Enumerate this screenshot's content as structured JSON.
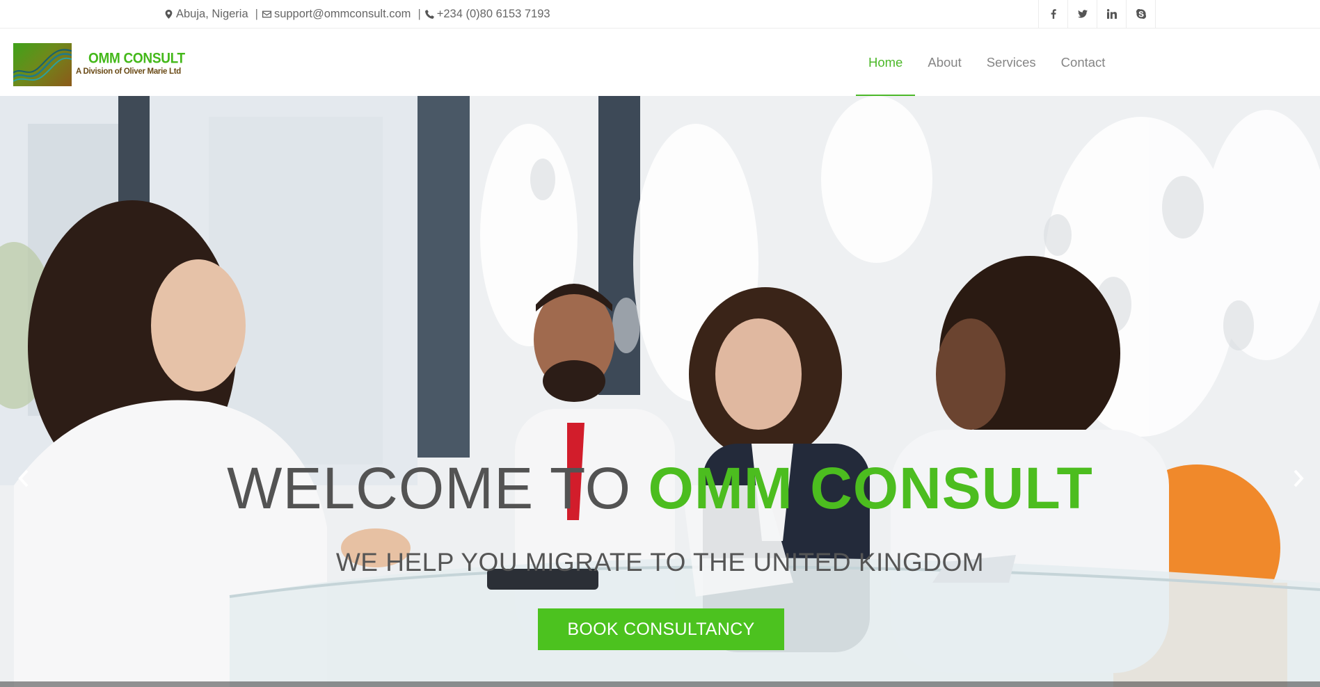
{
  "topbar": {
    "location": "Abuja, Nigeria",
    "email": "support@ommconsult.com",
    "phone": "+234 (0)80 6153 7193",
    "social": [
      {
        "icon": "facebook-icon",
        "glyph": "f"
      },
      {
        "icon": "twitter-icon",
        "glyph": "t"
      },
      {
        "icon": "linkedin-icon",
        "glyph": "in"
      },
      {
        "icon": "skype-icon",
        "glyph": "s"
      }
    ]
  },
  "logo": {
    "title": "OMM CONSULT",
    "subtitle": "A Division of Oliver Marie Ltd"
  },
  "nav": {
    "items": [
      {
        "label": "Home",
        "active": true
      },
      {
        "label": "About",
        "active": false
      },
      {
        "label": "Services",
        "active": false
      },
      {
        "label": "Contact",
        "active": false
      }
    ]
  },
  "hero": {
    "title_prefix": "WELCOME TO ",
    "title_accent": "OMM CONSULT",
    "subtitle": "WE HELP YOU MIGRATE TO THE UNITED KINGDOM",
    "cta_label": "BOOK CONSULTANCY",
    "prev_icon": "chevron-left-icon",
    "next_icon": "chevron-right-icon"
  },
  "colors": {
    "accent": "#4cbd1f",
    "nav_text": "#858585",
    "hero_text": "#535353"
  }
}
